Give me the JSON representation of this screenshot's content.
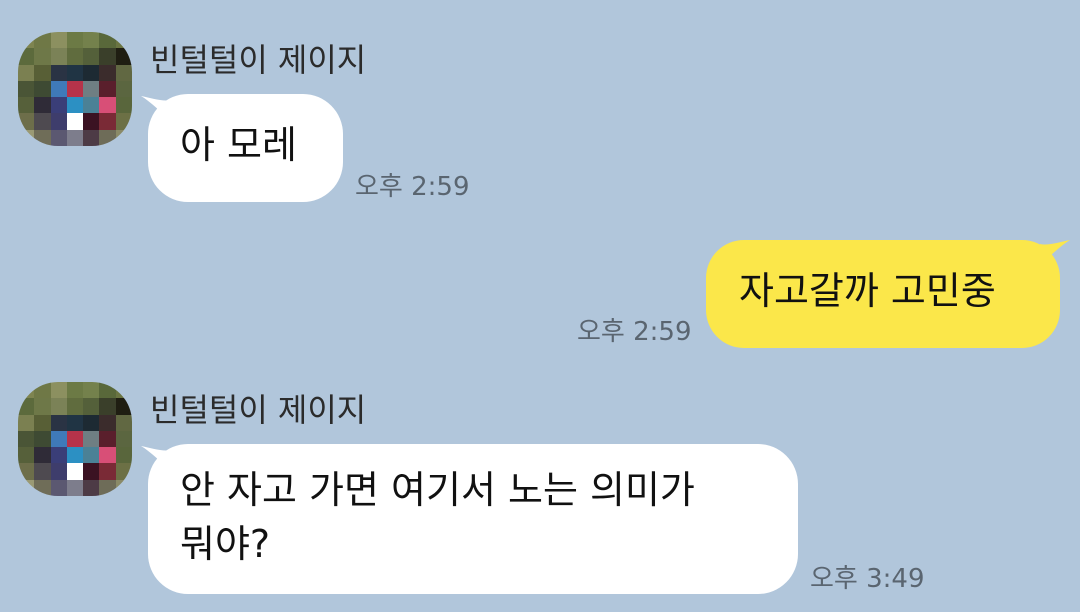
{
  "colors": {
    "background": "#b1c6db",
    "incoming_bubble": "#ffffff",
    "outgoing_bubble": "#fbe74a",
    "timestamp": "#5a6570"
  },
  "messages": [
    {
      "direction": "incoming",
      "sender": "빈털털이 제이지",
      "avatar": "pixelated-avatar",
      "text": "아 모레",
      "time": "오후 2:59"
    },
    {
      "direction": "outgoing",
      "text": "자고갈까 고민중",
      "time": "오후 2:59"
    },
    {
      "direction": "incoming",
      "sender": "빈털털이 제이지",
      "avatar": "pixelated-avatar",
      "text_lines": [
        "안 자고 가면 여기서 노는 의미가",
        "뭐야?"
      ],
      "time": "오후 3:49"
    }
  ]
}
